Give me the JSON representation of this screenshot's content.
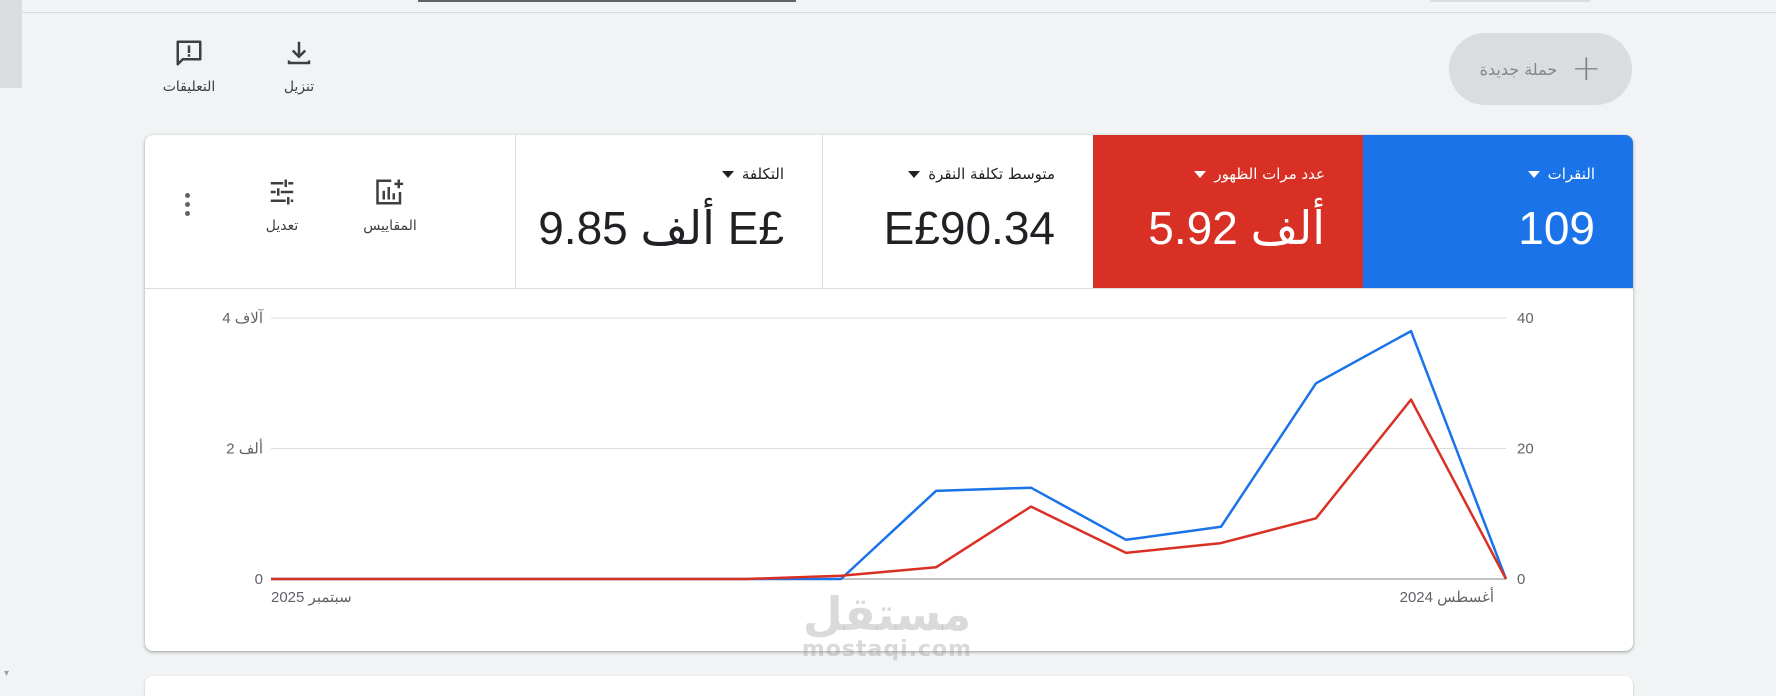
{
  "toolbar": {
    "new_campaign_label": "حملة جديدة",
    "download_label": "تنزيل",
    "feedback_label": "التعليقات"
  },
  "metrics": {
    "clicks": {
      "name": "النقرات",
      "value": "109",
      "color": "#1a73e8"
    },
    "impressions": {
      "name": "عدد مرات الظهور",
      "value": "5.92 ألف",
      "color": "#d93025"
    },
    "avg_cpc": {
      "name": "متوسط تكلفة النقرة",
      "value": "E£90.34"
    },
    "cost": {
      "name": "التكلفة",
      "value": "9.85 ألف E£"
    }
  },
  "card_tools": {
    "metrics_label": "المقاييس",
    "adjust_label": "تعديل"
  },
  "watermark": {
    "arabic": "مستقل",
    "latin": "mostaqi.com"
  },
  "chart_data": {
    "type": "line",
    "x_start_label": "أغسطس 2024",
    "x_end_label": "سبتمبر 2025",
    "direction": "rtl",
    "right_axis": {
      "ticks": [
        "0",
        "20",
        "40"
      ],
      "ylim": [
        0,
        40
      ]
    },
    "left_axis": {
      "ticks": [
        "0",
        "2 ألف",
        "4 آلاف"
      ],
      "ylim": [
        0,
        4000
      ]
    },
    "series": [
      {
        "name": "النقرات",
        "axis": "right",
        "color": "#1a73e8",
        "values": [
          0,
          38,
          30,
          8,
          6,
          14,
          13.5,
          0,
          0,
          0,
          0,
          0,
          0,
          0
        ]
      },
      {
        "name": "عدد مرات الظهور",
        "axis": "left",
        "color": "#d93025",
        "values": [
          0,
          2750,
          930,
          550,
          400,
          1110,
          180,
          50,
          0,
          0,
          0,
          0,
          0,
          0
        ]
      }
    ]
  }
}
